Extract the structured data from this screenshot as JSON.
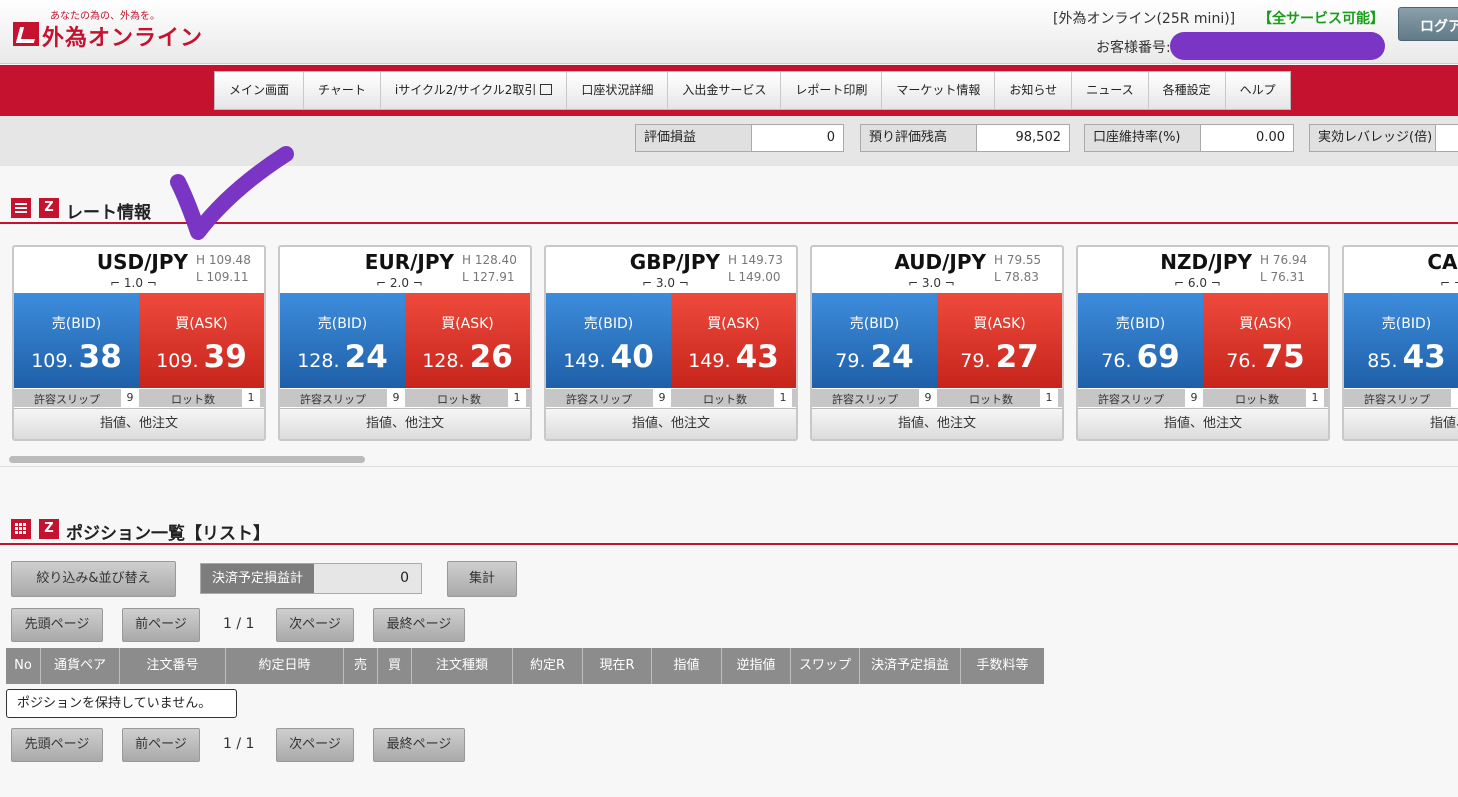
{
  "header": {
    "logo_tagline": "あなたの為の、外為を。",
    "logo_text": "外為オンライン",
    "account_type": "[外為オンライン(25R mini)]",
    "service_status": "【全サービス可能】",
    "customer_no_label": "お客様番号:",
    "logout_label": "ログアウト"
  },
  "nav": {
    "items": [
      "メイン画面",
      "チャート",
      "iサイクル2/サイクル2取引",
      "口座状況詳細",
      "入出金サービス",
      "レポート印刷",
      "マーケット情報",
      "お知らせ",
      "ニュース",
      "各種設定",
      "ヘルプ"
    ]
  },
  "summary": {
    "items": [
      {
        "label": "評価損益",
        "value": "0"
      },
      {
        "label": "預り評価残高",
        "value": "98,502"
      },
      {
        "label": "口座維持率(%)",
        "value": "0.00"
      },
      {
        "label": "実効レバレッジ(倍)",
        "value": ""
      }
    ]
  },
  "rates": {
    "title": "レート情報",
    "bid_label": "売(BID)",
    "ask_label": "買(ASK)",
    "slip_label": "許容スリップ",
    "lot_label": "ロット数",
    "order_label": "指値、他注文",
    "cards": [
      {
        "pair": "USD/JPY",
        "high": "H 109.48",
        "low": "L 109.11",
        "spread": "1.0",
        "bid_int": "109.",
        "bid_dec": "38",
        "ask_int": "109.",
        "ask_dec": "39",
        "slip": "9",
        "lot": "1"
      },
      {
        "pair": "EUR/JPY",
        "high": "H 128.40",
        "low": "L 127.91",
        "spread": "2.0",
        "bid_int": "128.",
        "bid_dec": "24",
        "ask_int": "128.",
        "ask_dec": "26",
        "slip": "9",
        "lot": "1"
      },
      {
        "pair": "GBP/JPY",
        "high": "H 149.73",
        "low": "L 149.00",
        "spread": "3.0",
        "bid_int": "149.",
        "bid_dec": "40",
        "ask_int": "149.",
        "ask_dec": "43",
        "slip": "9",
        "lot": "1"
      },
      {
        "pair": "AUD/JPY",
        "high": "H 79.55",
        "low": "L 78.83",
        "spread": "3.0",
        "bid_int": "79.",
        "bid_dec": "24",
        "ask_int": "79.",
        "ask_dec": "27",
        "slip": "9",
        "lot": "1"
      },
      {
        "pair": "NZD/JPY",
        "high": "H 76.94",
        "low": "L 76.31",
        "spread": "6.0",
        "bid_int": "76.",
        "bid_dec": "69",
        "ask_int": "76.",
        "ask_dec": "75",
        "slip": "9",
        "lot": "1"
      },
      {
        "pair": "CAD/JPY",
        "high": "",
        "low": "",
        "spread": "",
        "bid_int": "85.",
        "bid_dec": "43",
        "ask_int": "",
        "ask_dec": "",
        "slip": "",
        "lot": ""
      }
    ]
  },
  "positions": {
    "title": "ポジション一覧【リスト】",
    "filter_label": "絞り込み&並び替え",
    "pl_label": "決済予定損益計",
    "pl_value": "0",
    "aggregate_label": "集計",
    "first_page": "先頭ページ",
    "prev_page": "前ページ",
    "page_info": "1 / 1",
    "next_page": "次ページ",
    "last_page": "最終ページ",
    "columns": [
      "No",
      "通貨ペア",
      "注文番号",
      "約定日時",
      "売",
      "買",
      "注文種類",
      "約定R",
      "現在R",
      "指値",
      "逆指値",
      "スワップ",
      "決済予定損益",
      "手数料等"
    ],
    "empty_message": "ポジションを保持していません。"
  },
  "colors": {
    "brand_red": "#c4122f",
    "bid_blue": "#2a6fc0",
    "ask_red": "#d8322a",
    "annotation_purple": "#7b35c4"
  }
}
